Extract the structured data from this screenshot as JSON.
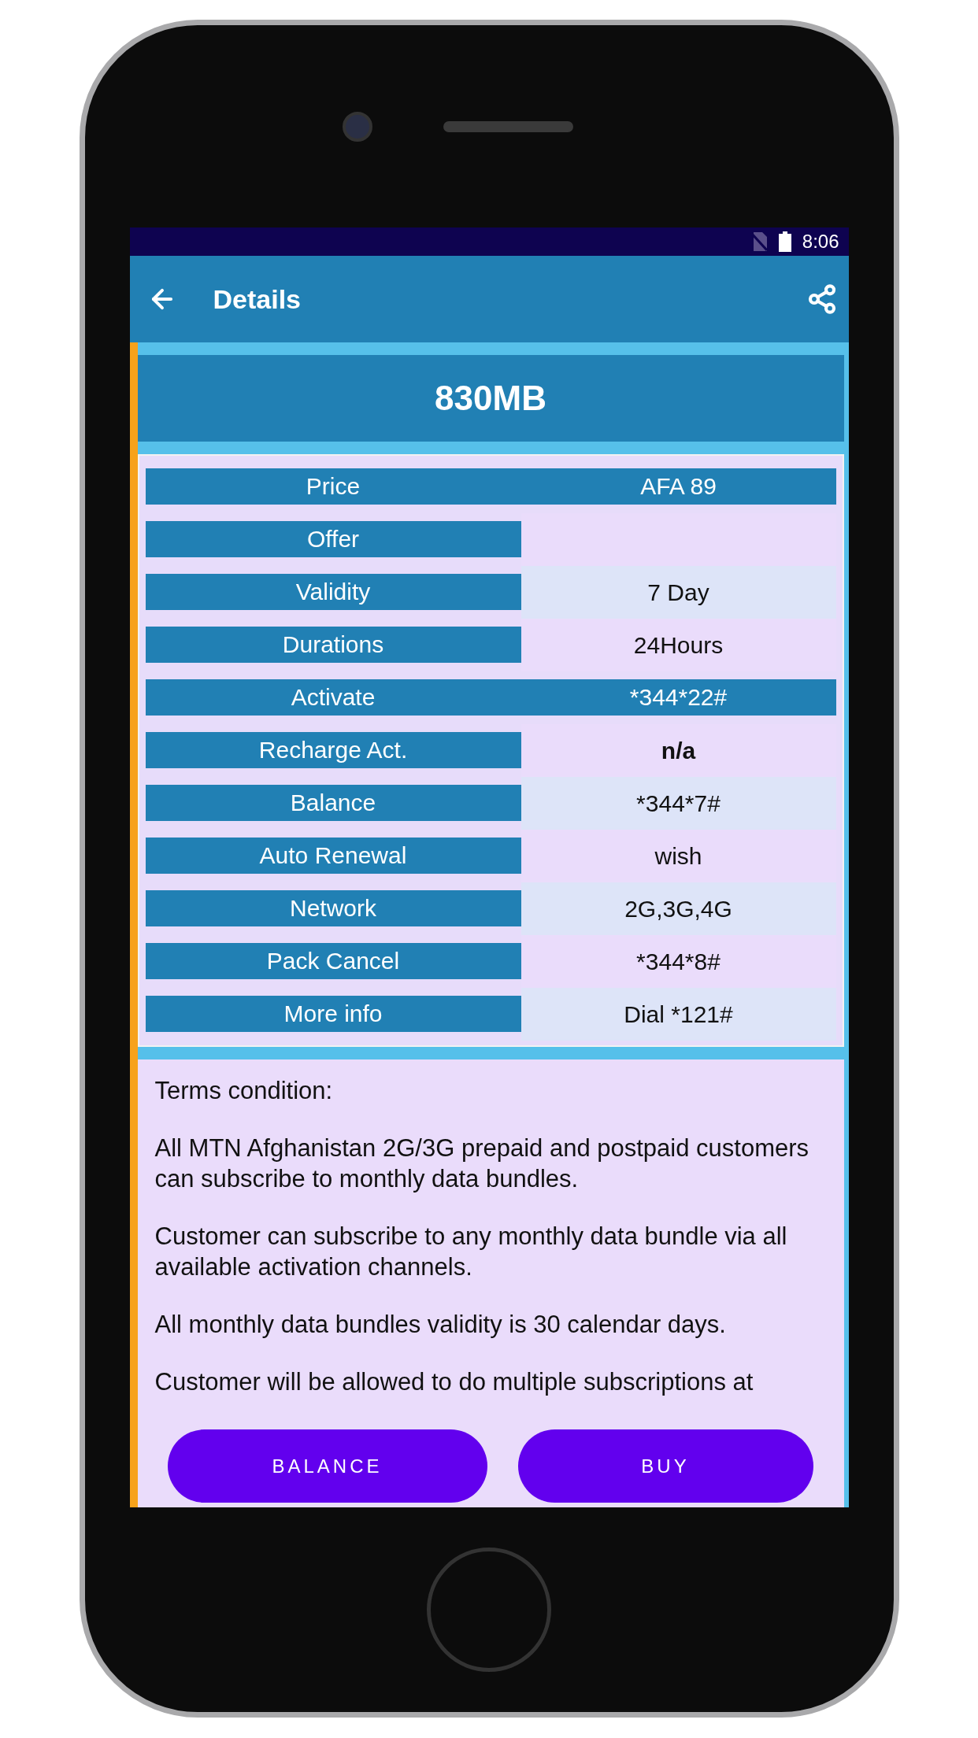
{
  "status_bar": {
    "time": "8:06"
  },
  "app_bar": {
    "title": "Details"
  },
  "pack": {
    "title": "830MB",
    "rows": [
      {
        "label": "Price",
        "value": "AFA 89",
        "kind": "highlight"
      },
      {
        "label": "Offer",
        "kind": "plain"
      },
      {
        "label": "Validity",
        "value": "7 Day",
        "kind": "plain"
      },
      {
        "label": "Durations",
        "value": "24Hours",
        "kind": "plain"
      },
      {
        "label": "Activate",
        "value": "*344*22#",
        "kind": "highlight"
      },
      {
        "label": "Recharge Act.",
        "value": "n/a",
        "kind": "bold"
      },
      {
        "label": "Balance",
        "value": "*344*7#",
        "kind": "plain"
      },
      {
        "label": "Auto Renewal",
        "value": "wish",
        "kind": "plain"
      },
      {
        "label": "Network",
        "value": "2G,3G,4G",
        "kind": "plain"
      },
      {
        "label": "Pack Cancel",
        "value": "*344*8#",
        "kind": "plain"
      },
      {
        "label": "More info",
        "value": "Dial *121#",
        "kind": "plain"
      }
    ]
  },
  "terms": {
    "paragraphs": [
      "Terms condition:",
      "All MTN Afghanistan 2G/3G prepaid and postpaid customers can subscribe to monthly data bundles.",
      "Customer can subscribe to any monthly data bundle via all available activation channels.",
      "All monthly data bundles validity is 30 calendar days.",
      "Customer will be allowed to do multiple subscriptions at"
    ]
  },
  "buttons": [
    "BALANCE",
    "BUY"
  ]
}
